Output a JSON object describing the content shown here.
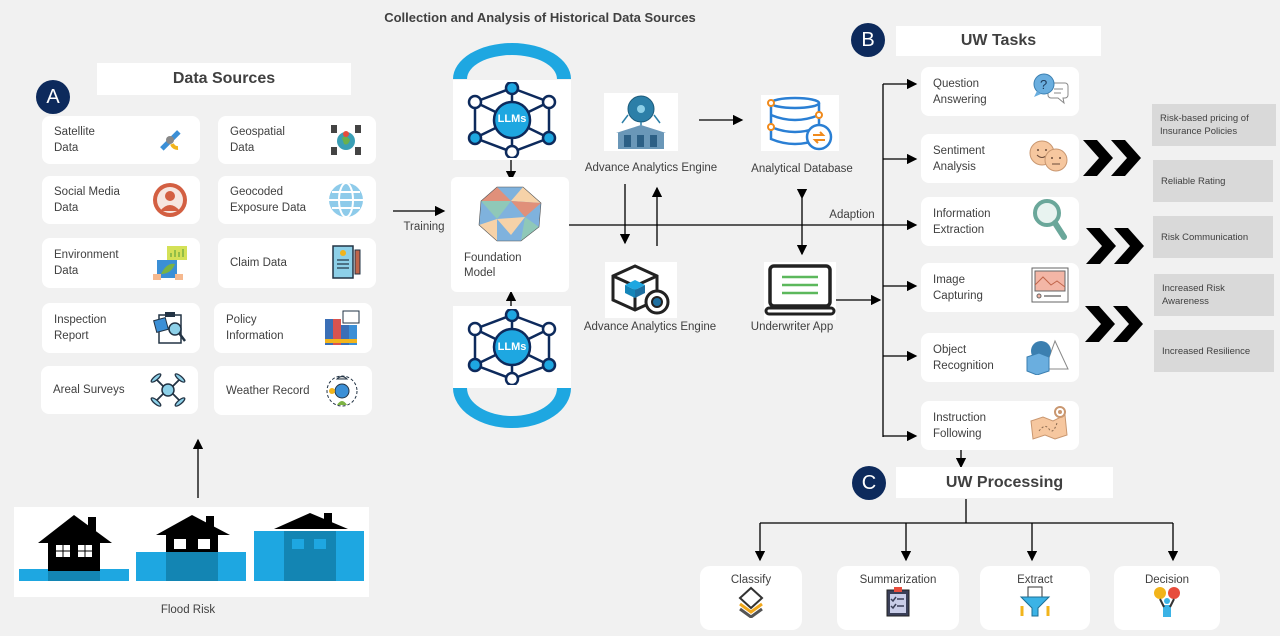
{
  "title": "Collection and Analysis of Historical Data Sources",
  "section_a": {
    "badge": "A",
    "header": "Data Sources",
    "sources": [
      {
        "label": "Satellite\nData",
        "icon": "satellite-icon"
      },
      {
        "label": "Geospatial\nData",
        "icon": "geospatial-globe-icon"
      },
      {
        "label": "Social  Media\nData",
        "icon": "user-avatar-icon"
      },
      {
        "label": "Geocoded\nExposure Data",
        "icon": "globe-icon"
      },
      {
        "label": "Environment\nData",
        "icon": "environment-chart-icon"
      },
      {
        "label": "Claim  Data",
        "icon": "claim-document-icon"
      },
      {
        "label": "Inspection\nReport",
        "icon": "inspection-clipboard-icon"
      },
      {
        "label": "Policy\nInformation",
        "icon": "policy-binders-icon"
      },
      {
        "label": "Areal Surveys",
        "icon": "drone-icon"
      },
      {
        "label": "Weather Record",
        "icon": "weather-globe-icon"
      }
    ],
    "flood_caption": "Flood Risk"
  },
  "center": {
    "training_label": "Training",
    "llm_label": "LLMs",
    "foundation_label": "Foundation\nModel",
    "analytics_engine_top": "Advance  Analytics  Engine",
    "analytics_engine_bottom": "Advance  Analytics  Engine",
    "analytical_database": "Analytical  Database",
    "underwriter_app": "Underwriter App",
    "adaption_label": "Adaption"
  },
  "section_b": {
    "badge": "B",
    "header": "UW Tasks",
    "tasks": [
      {
        "label": "Question\nAnswering",
        "icon": "question-chat-icon"
      },
      {
        "label": "Sentiment\nAnalysis",
        "icon": "faces-icon"
      },
      {
        "label": "Information\nExtraction",
        "icon": "magnifier-icon"
      },
      {
        "label": "Image\nCapturing",
        "icon": "image-frame-icon"
      },
      {
        "label": "Object\nRecognition",
        "icon": "shapes-icon"
      },
      {
        "label": "Instruction\nFollowing",
        "icon": "map-pin-icon"
      }
    ],
    "outcomes": [
      "Risk-based pricing of\nInsurance Policies",
      "Reliable Rating",
      "Risk Communication",
      "Increased Risk\nAwareness",
      "Increased Resilience"
    ]
  },
  "section_c": {
    "badge": "C",
    "header": "UW Processing",
    "steps": [
      {
        "label": "Classify",
        "icon": "layers-icon"
      },
      {
        "label": "Summarization",
        "icon": "checklist-icon"
      },
      {
        "label": "Extract",
        "icon": "funnel-icon"
      },
      {
        "label": "Decision",
        "icon": "decision-person-icon"
      }
    ]
  },
  "colors": {
    "background": "#f1f1f1",
    "badge": "#0d2a5c",
    "accent_blue": "#1ea7e1",
    "outcome_box": "#d9d9d9"
  }
}
